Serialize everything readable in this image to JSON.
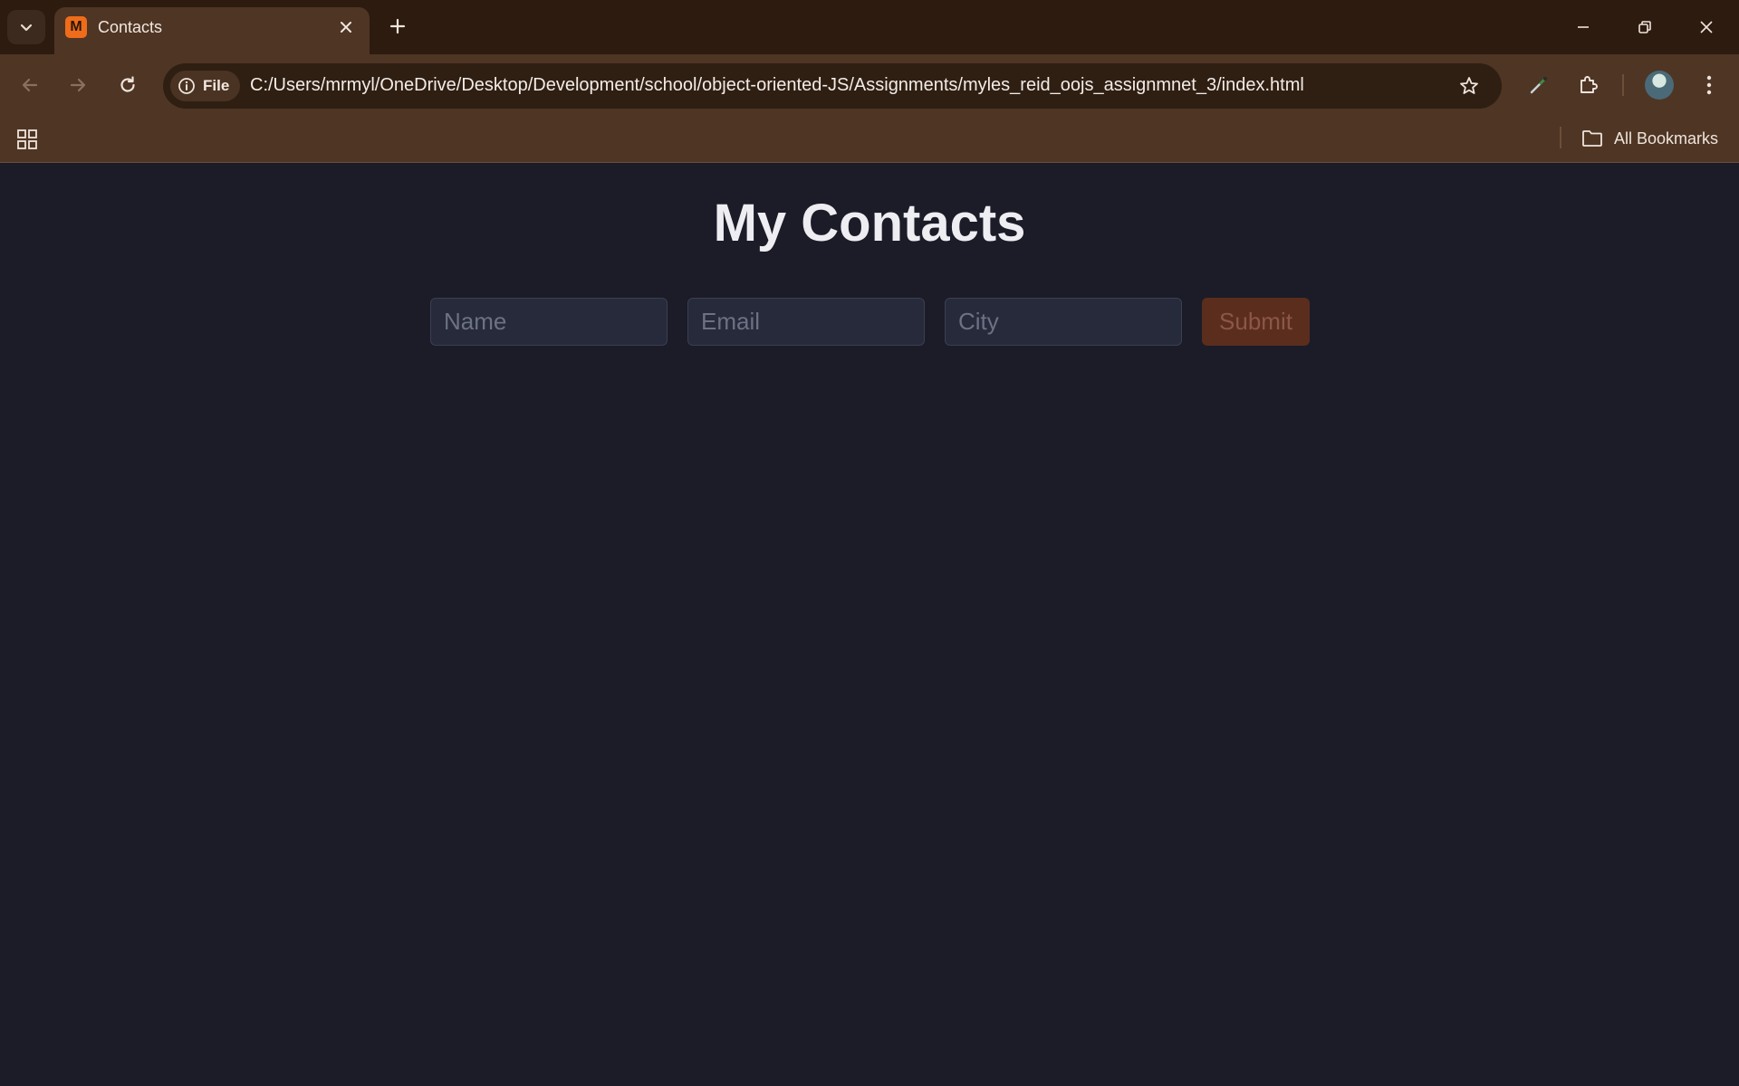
{
  "browser": {
    "tab": {
      "title": "Contacts",
      "favicon_letter": "M"
    },
    "omnibox": {
      "scheme_chip": "File",
      "url": "C:/Users/mrmyl/OneDrive/Desktop/Development/school/object-oriented-JS/Assignments/myles_reid_oojs_assignmnet_3/index.html"
    },
    "bookmarks": {
      "all_bookmarks_label": "All Bookmarks"
    },
    "colors": {
      "frame": "#2d1b0f",
      "toolbar": "#4f3524",
      "omnibox": "#2f1f13",
      "favicon": "#ef6c1a"
    }
  },
  "page": {
    "title": "My Contacts",
    "form": {
      "name_placeholder": "Name",
      "email_placeholder": "Email",
      "city_placeholder": "City",
      "submit_label": "Submit"
    },
    "colors": {
      "background": "#1b1c28",
      "input": "#262a3a",
      "submit": "#5b2d1d"
    }
  }
}
